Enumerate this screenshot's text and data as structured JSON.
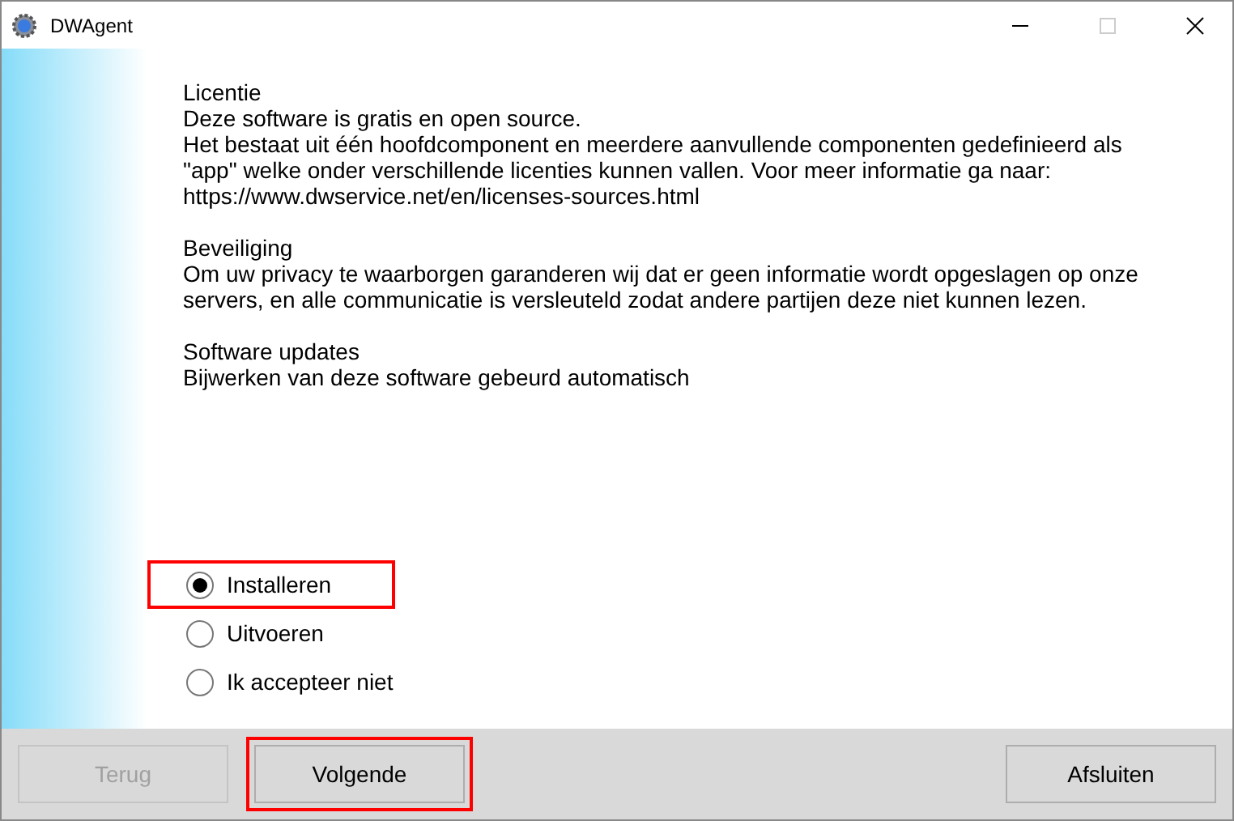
{
  "window": {
    "title": "DWAgent"
  },
  "sections": [
    {
      "lines": [
        "Licentie",
        "Deze software is gratis en open source.",
        "Het bestaat uit één hoofdcomponent en meerdere aanvullende componenten gedefinieerd als",
        "\"app\" welke onder verschillende licenties kunnen vallen. Voor meer informatie ga naar:",
        "https://www.dwservice.net/en/licenses-sources.html"
      ]
    },
    {
      "lines": [
        "Beveiliging",
        "Om uw privacy te waarborgen garanderen wij dat er geen informatie wordt opgeslagen op onze",
        "servers, en alle communicatie is versleuteld zodat andere partijen deze niet kunnen lezen."
      ]
    },
    {
      "lines": [
        "Software updates",
        "Bijwerken van deze software gebeurd automatisch"
      ]
    }
  ],
  "options": [
    {
      "label": "Installeren",
      "selected": true,
      "highlighted": true
    },
    {
      "label": "Uitvoeren",
      "selected": false,
      "highlighted": false
    },
    {
      "label": "Ik accepteer niet",
      "selected": false,
      "highlighted": false
    }
  ],
  "buttons": [
    {
      "label": "Terug",
      "disabled": true,
      "highlighted": false
    },
    {
      "label": "Volgende",
      "disabled": false,
      "highlighted": true
    }
  ],
  "close_button": {
    "label": "Afsluiten"
  }
}
